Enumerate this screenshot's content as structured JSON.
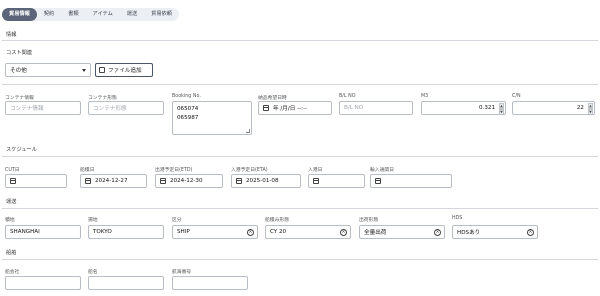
{
  "tabs": [
    {
      "label": "貿易情報",
      "active": true
    },
    {
      "label": "契約"
    },
    {
      "label": "書類"
    },
    {
      "label": "アイテム"
    },
    {
      "label": "運送"
    },
    {
      "label": "貿易依頼"
    }
  ],
  "sections": {
    "info": "情報",
    "cost": "コスト関連",
    "schedule": "スケジュール",
    "transport": "運送",
    "ship": "船舶"
  },
  "cost": {
    "select_value": "その他",
    "add_file_label": "ファイル追加"
  },
  "info_fields": {
    "container_info": {
      "label": "コンテナ情報",
      "placeholder": "コンテナ情報"
    },
    "container_type": {
      "label": "コンテナ形態",
      "placeholder": "コンテナ形態"
    },
    "booking_no": {
      "label": "Booking No.",
      "line1": "065074",
      "line2": "065987"
    },
    "delivery_date": {
      "label": "納品希望日時",
      "value": "年 /月/日 --:--"
    },
    "bl_no": {
      "label": "B/L NO",
      "placeholder": "B/L NO"
    },
    "m3": {
      "label": "M3",
      "value": "0.321"
    },
    "cn": {
      "label": "C/N",
      "value": "22"
    }
  },
  "schedule": [
    {
      "label": "CUT日",
      "value": ""
    },
    {
      "label": "船積日",
      "value": "2024-12-27"
    },
    {
      "label": "出港予定日(ETD)",
      "value": "2024-12-30"
    },
    {
      "label": "入港予定日(ETA)",
      "value": "2025-01-08"
    },
    {
      "label": "入港日",
      "value": ""
    },
    {
      "label": "輸入通関日",
      "value": ""
    }
  ],
  "transport": [
    {
      "label": "積地",
      "value": "SHANGHAI"
    },
    {
      "label": "揚地",
      "value": "TOKYO"
    },
    {
      "label": "区分",
      "value": "SHIP"
    },
    {
      "label": "船積み形態",
      "value": "CY 20"
    },
    {
      "label": "出荷形態",
      "value": "全量出荷"
    },
    {
      "label": "HDS",
      "value": "HDSあり"
    }
  ],
  "ship": [
    {
      "label": "船会社"
    },
    {
      "label": "船名"
    },
    {
      "label": "航海番号"
    }
  ],
  "colors": {
    "active_tab": "#5b6478",
    "tab_bar": "#eceff3",
    "border": "#b9bec6"
  }
}
